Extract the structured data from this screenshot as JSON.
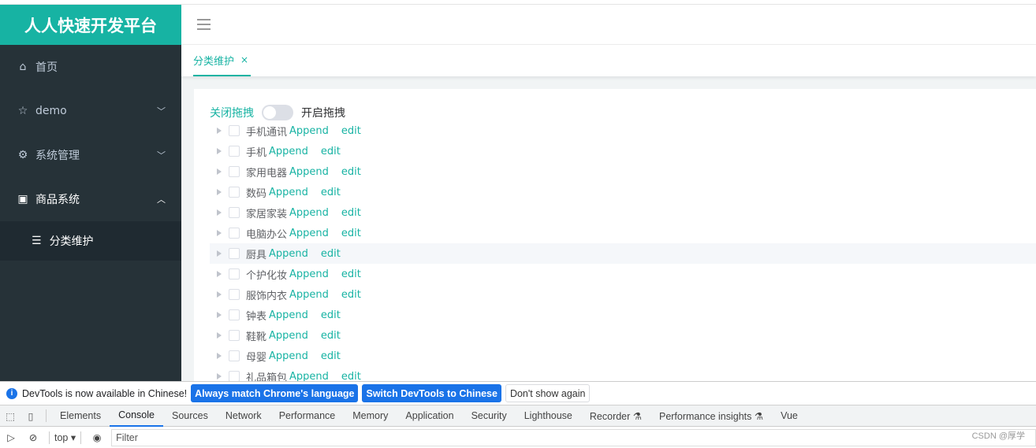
{
  "app": {
    "title": "人人快速开发平台"
  },
  "sidebar": {
    "items": [
      {
        "label": "首页",
        "icon": "home-icon"
      },
      {
        "label": "demo",
        "icon": "star-icon"
      },
      {
        "label": "系统管理",
        "icon": "gear-icon"
      },
      {
        "label": "商品系统",
        "icon": "product-icon",
        "expanded": true
      }
    ],
    "sub_items": [
      {
        "label": "分类维护",
        "icon": "list-icon",
        "active": true
      }
    ]
  },
  "tabs": [
    {
      "label": "分类维护",
      "close": "×"
    }
  ],
  "switch": {
    "off_label": "关闭拖拽",
    "on_label": "开启拖拽",
    "value": false
  },
  "tree": {
    "append_label": "Append",
    "edit_label": "edit",
    "nodes": [
      "手机通讯",
      "手机",
      "家用电器",
      "数码",
      "家居家装",
      "电脑办公",
      "厨具",
      "个护化妆",
      "服饰内衣",
      "钟表",
      "鞋靴",
      "母婴",
      "礼品箱包"
    ]
  },
  "devtools": {
    "info": "DevTools is now available in Chinese!",
    "btn_match": "Always match Chrome's language",
    "btn_switch": "Switch DevTools to Chinese",
    "btn_dismiss": "Don't show again",
    "tabs": [
      "Elements",
      "Console",
      "Sources",
      "Network",
      "Performance",
      "Memory",
      "Application",
      "Security",
      "Lighthouse",
      "Recorder ⚗",
      "Performance insights ⚗",
      "Vue"
    ],
    "active_tab": "Console",
    "context": "top",
    "filter_placeholder": "Filter",
    "watermark": "CSDN @厚学"
  },
  "colors": {
    "accent": "#17b3a3",
    "sidebar": "#263238",
    "devtools_blue": "#1a73e8"
  }
}
